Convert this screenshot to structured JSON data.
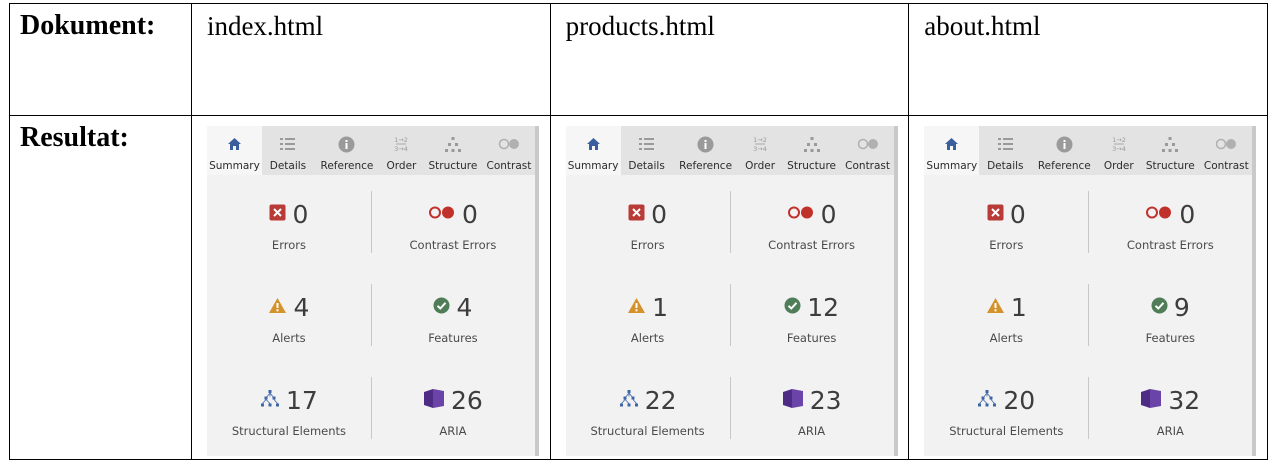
{
  "labels": {
    "document": "Dokument:",
    "result": "Resultat:"
  },
  "documents": [
    {
      "file": "index.html",
      "errors": "0",
      "contrast_errors": "0",
      "alerts": "4",
      "features": "4",
      "structural": "17",
      "aria": "26"
    },
    {
      "file": "products.html",
      "errors": "0",
      "contrast_errors": "0",
      "alerts": "1",
      "features": "12",
      "structural": "22",
      "aria": "23"
    },
    {
      "file": "about.html",
      "errors": "0",
      "contrast_errors": "0",
      "alerts": "1",
      "features": "9",
      "structural": "20",
      "aria": "32"
    }
  ],
  "tabs": [
    "Summary",
    "Details",
    "Reference",
    "Order",
    "Structure",
    "Contrast"
  ],
  "metric_labels": {
    "errors": "Errors",
    "contrast_errors": "Contrast Errors",
    "alerts": "Alerts",
    "features": "Features",
    "structural": "Structural Elements",
    "aria": "ARIA"
  },
  "colors": {
    "error": "#b83b37",
    "contrast": "#c0312c",
    "alert": "#d5912a",
    "feature": "#4f7d58",
    "structure": "#3f67a8",
    "aria": "#4e2b85",
    "tab_active": "#3b5e9c",
    "tab_icon": "#9a9a9a"
  },
  "icons": [
    "home-icon",
    "list-icon",
    "info-icon",
    "order-icon",
    "hierarchy-icon",
    "contrast-icon",
    "error-icon",
    "alert-icon",
    "check-icon",
    "aria-icon"
  ]
}
